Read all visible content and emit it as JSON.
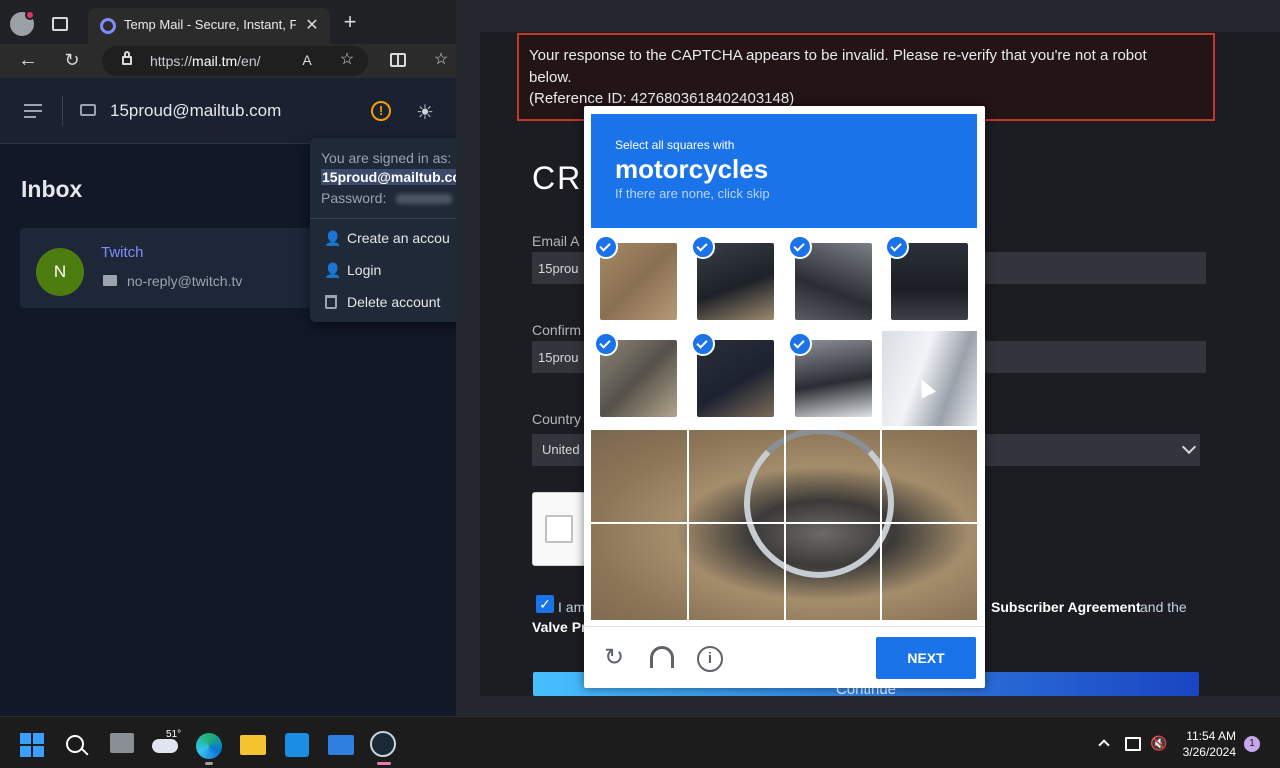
{
  "browser": {
    "tab_title": "Temp Mail - Secure, Instant, Fast",
    "url_prefix": "https://",
    "url_host": "mail.tm",
    "url_path": "/en/"
  },
  "mail": {
    "account_email": "15proud@mailtub.com",
    "inbox_title": "Inbox",
    "messages": [
      {
        "avatar_letter": "N",
        "sender": "Twitch",
        "from": "no-reply@twitch.tv"
      }
    ],
    "account_menu": {
      "signed_in_label": "You are signed in as:",
      "signed_in_email": "15proud@mailtub.co",
      "password_label": "Password:",
      "items": [
        "Create an accou",
        "Login",
        "Delete account"
      ]
    }
  },
  "steam": {
    "error_line1": "Your response to the CAPTCHA appears to be invalid. Please re-verify that you're not a robot",
    "error_line2": "below.",
    "error_line3": "(Reference ID: 4276803618402403148)",
    "heading_fragment": "CRI",
    "email_label": "Email A",
    "email_value": "15prou",
    "confirm_label": "Confirm",
    "confirm_value": "15prou",
    "country_label": "Country",
    "country_value": "United",
    "agree_prefix": "I am",
    "agree_link": "Subscriber Agreement",
    "agree_mid": "and the",
    "agree_line2": "Valve Pr",
    "continue_label": "Continue"
  },
  "captcha": {
    "instruction": "Select all squares with",
    "target": "motorcycles",
    "hint": "If there are none, click skip",
    "next_label": "NEXT",
    "selected_tiles": [
      0,
      1,
      2,
      3,
      4,
      5,
      6
    ],
    "accent_color": "#1a73e8"
  },
  "taskbar": {
    "weather": "51°",
    "time": "11:54 AM",
    "date": "3/26/2024",
    "notification_count": "1"
  }
}
